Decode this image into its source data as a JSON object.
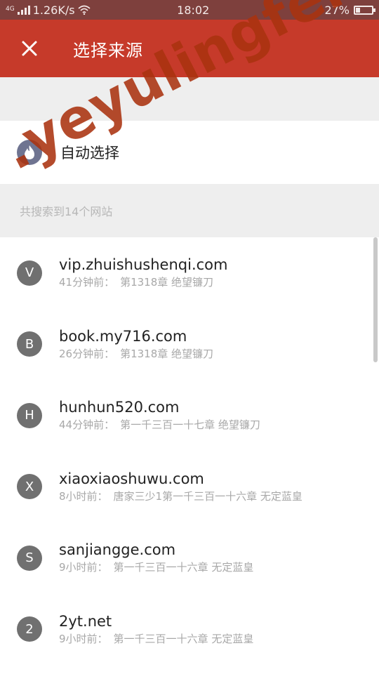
{
  "status_bar": {
    "signal_label": "4G",
    "speed": "1.26K/s",
    "time": "18:02",
    "battery_text": "27%",
    "battery_level": 0.27
  },
  "toolbar": {
    "title": "选择来源",
    "close_icon": "close-icon"
  },
  "auto_select": {
    "label": "自动选择",
    "icon": "flame-icon"
  },
  "section": {
    "header": "共搜索到14个网站"
  },
  "sources": [
    {
      "initial": "V",
      "domain": "vip.zhuishushenqi.com",
      "time": "41分钟前：",
      "chapter": "第1318章 绝望镰刀"
    },
    {
      "initial": "B",
      "domain": "book.my716.com",
      "time": "26分钟前：",
      "chapter": "第1318章 绝望镰刀"
    },
    {
      "initial": "H",
      "domain": "hunhun520.com",
      "time": "44分钟前：",
      "chapter": "第一千三百一十七章 绝望镰刀"
    },
    {
      "initial": "X",
      "domain": "xiaoxiaoshuwu.com",
      "time": "8小时前：",
      "chapter": "唐家三少1第一千三百一十六章 无定蓝皇"
    },
    {
      "initial": "S",
      "domain": "sanjiangge.com",
      "time": "9小时前：",
      "chapter": "第一千三百一十六章 无定蓝皇"
    },
    {
      "initial": "2",
      "domain": "2yt.net",
      "time": "9小时前：",
      "chapter": "第一千三百一十六章 无定蓝皇"
    }
  ],
  "watermark": ".yeyulingfeng.c",
  "colors": {
    "status_bar": "#7e403d",
    "toolbar": "#c63a2a",
    "avatar": "#707070",
    "auto_icon": "#6f7491"
  }
}
